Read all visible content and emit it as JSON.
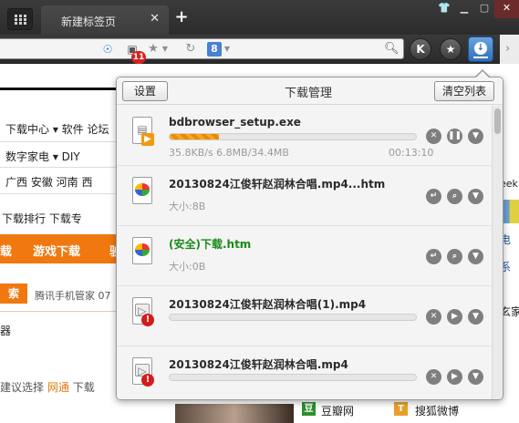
{
  "browser": {
    "tab_title": "新建标签页",
    "tab_close": "✕",
    "new_tab": "+",
    "window_buttons": {
      "skin": "👕",
      "minimize": "▁",
      "maximize": "▢",
      "close": "✕"
    }
  },
  "toolbar": {
    "mail_badge": "11",
    "k_button": "K",
    "fav_button": "★",
    "engine_letter": "8"
  },
  "background_page": {
    "nav": "下载中心 ▾   软件  论坛",
    "categories": "数字家电 ▾   DIY",
    "regions": "广西  安徽  河南  西",
    "links": "下载排行   下载专",
    "orange_bar": [
      "载",
      "游戏下载",
      "驶"
    ],
    "search_btn": "索",
    "search_text": "腾讯手机管家 07",
    "qi": "器",
    "suggest_prefix": "建议选择",
    "suggest_highlight": "网通",
    "suggest_suffix": "下载",
    "right_peek": "eek",
    "right_1": "电",
    "right_2": "系",
    "right_3": "玄家",
    "douban": "豆瓣网",
    "weibo": "搜狐微博"
  },
  "download_manager": {
    "title": "下载管理",
    "settings_label": "设置",
    "clear_label": "清空列表",
    "items": [
      {
        "name": "bdbrowser_setup.exe",
        "meta": "35.8KB/s 6.8MB/34.4MB",
        "time": "00:13:10",
        "progress": 0.2,
        "state": "downloading"
      },
      {
        "name": "20130824江俊轩赵润林合唱.mp4...htm",
        "meta": "大小:8B",
        "state": "completed"
      },
      {
        "name": "(安全)下载.htm",
        "meta": "大小:0B",
        "state": "completed-safe"
      },
      {
        "name": "20130824江俊轩赵润林合唱(1).mp4",
        "progress": 0,
        "state": "error"
      },
      {
        "name": "20130824江俊轩赵润林合唱.mp4",
        "progress": 0,
        "state": "error"
      }
    ]
  }
}
